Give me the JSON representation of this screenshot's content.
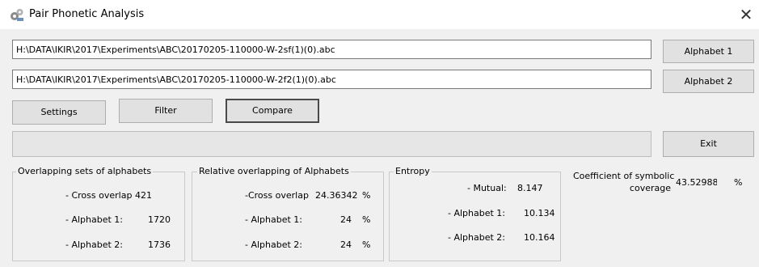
{
  "window": {
    "title": "Pair Phonetic Analysis",
    "app_icon": "gears-icon",
    "close_icon": "close-icon"
  },
  "files": {
    "path1": "H:\\DATA\\IKIR\\2017\\Experiments\\ABC\\20170205-110000-W-2sf(1)(0).abc",
    "path2": "H:\\DATA\\IKIR\\2017\\Experiments\\ABC\\20170205-110000-W-2f2(1)(0).abc"
  },
  "buttons": {
    "alphabet1": "Alphabet 1",
    "alphabet2": "Alphabet 2",
    "settings": "Settings",
    "filter": "Filter",
    "compare": "Compare",
    "exit": "Exit"
  },
  "overlap_sets": {
    "title": "Overlapping sets of alphabets",
    "cross_label": "- Cross overlap",
    "cross_value": "421",
    "a1_label": "- Alphabet 1:",
    "a1_value": "1720",
    "a2_label": "- Alphabet 2:",
    "a2_value": "1736"
  },
  "relative_overlap": {
    "title": "Relative overlapping of Alphabets",
    "cross_label": "-Cross overlap",
    "cross_value": "24.36342",
    "cross_unit": "%",
    "a1_label": "- Alphabet 1:",
    "a1_value": "24",
    "a1_unit": "%",
    "a2_label": "- Alphabet 2:",
    "a2_value": "24",
    "a2_unit": "%"
  },
  "entropy": {
    "title": "Entropy",
    "mutual_label": "- Mutual:",
    "mutual_value": "8.147",
    "a1_label": "- Alphabet 1:",
    "a1_value": "10.134",
    "a2_label": "- Alphabet 2:",
    "a2_value": "10.164"
  },
  "coverage": {
    "label_line1": "Coefficient of symbolic",
    "label_line2": "coverage",
    "value": "43.52988",
    "unit": "%"
  }
}
